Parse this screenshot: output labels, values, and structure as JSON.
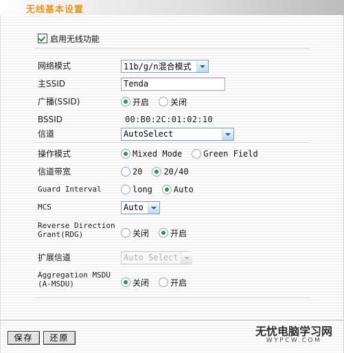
{
  "header": {
    "title": "无线基本设置",
    "title_color": "#e8951c"
  },
  "form": {
    "enable_wireless": {
      "label": "启用无线功能",
      "checked": true
    },
    "rows": [
      {
        "name": "network-mode",
        "label": "网络模式",
        "type": "select",
        "value": "11b/g/n混合模式"
      },
      {
        "name": "primary-ssid",
        "label": "主SSID",
        "type": "text",
        "value": "Tenda",
        "placeholder": ""
      },
      {
        "name": "broadcast-ssid",
        "label": "广播(SSID)",
        "type": "radio",
        "options": [
          "开启",
          "关闭"
        ],
        "selected": "开启"
      },
      {
        "name": "bssid",
        "label": "BSSID",
        "type": "static",
        "value": "00:B0:2C:01:02:10"
      },
      {
        "name": "channel",
        "label": "信道",
        "type": "select",
        "value": "AutoSelect"
      },
      {
        "name": "operating-mode",
        "label": "操作模式",
        "type": "radio",
        "options": [
          "Mixed Mode",
          "Green Field"
        ],
        "selected": "Mixed Mode"
      },
      {
        "name": "channel-bandwidth",
        "label": "信道带宽",
        "type": "radio",
        "options": [
          "20",
          "20/40"
        ],
        "selected": "20/40"
      },
      {
        "name": "guard-interval",
        "label": "Guard Interval",
        "type": "radio",
        "options": [
          "long",
          "Auto"
        ],
        "selected": "Auto"
      },
      {
        "name": "mcs",
        "label": "MCS",
        "type": "select",
        "value": "Auto"
      },
      {
        "name": "reverse-direction-grant",
        "label_line1": "Reverse Direction",
        "label_line2": "Grant(RDG)",
        "type": "radio",
        "options": [
          "关闭",
          "开启"
        ],
        "selected": "开启"
      },
      {
        "name": "extension-channel",
        "label": "扩展信道",
        "type": "select",
        "value": "Auto Select",
        "disabled": true
      },
      {
        "name": "aggregation-msdu",
        "label_line1": "Aggregation MSDU",
        "label_line2": "(A-MSDU)",
        "type": "radio",
        "options": [
          "关闭",
          "开启"
        ],
        "selected": "关闭"
      }
    ]
  },
  "footer": {
    "save_label": "保存",
    "reset_label": "还原",
    "watermark_cn": "无忧电脑学习网",
    "watermark_en": "WYPCW.COM"
  }
}
